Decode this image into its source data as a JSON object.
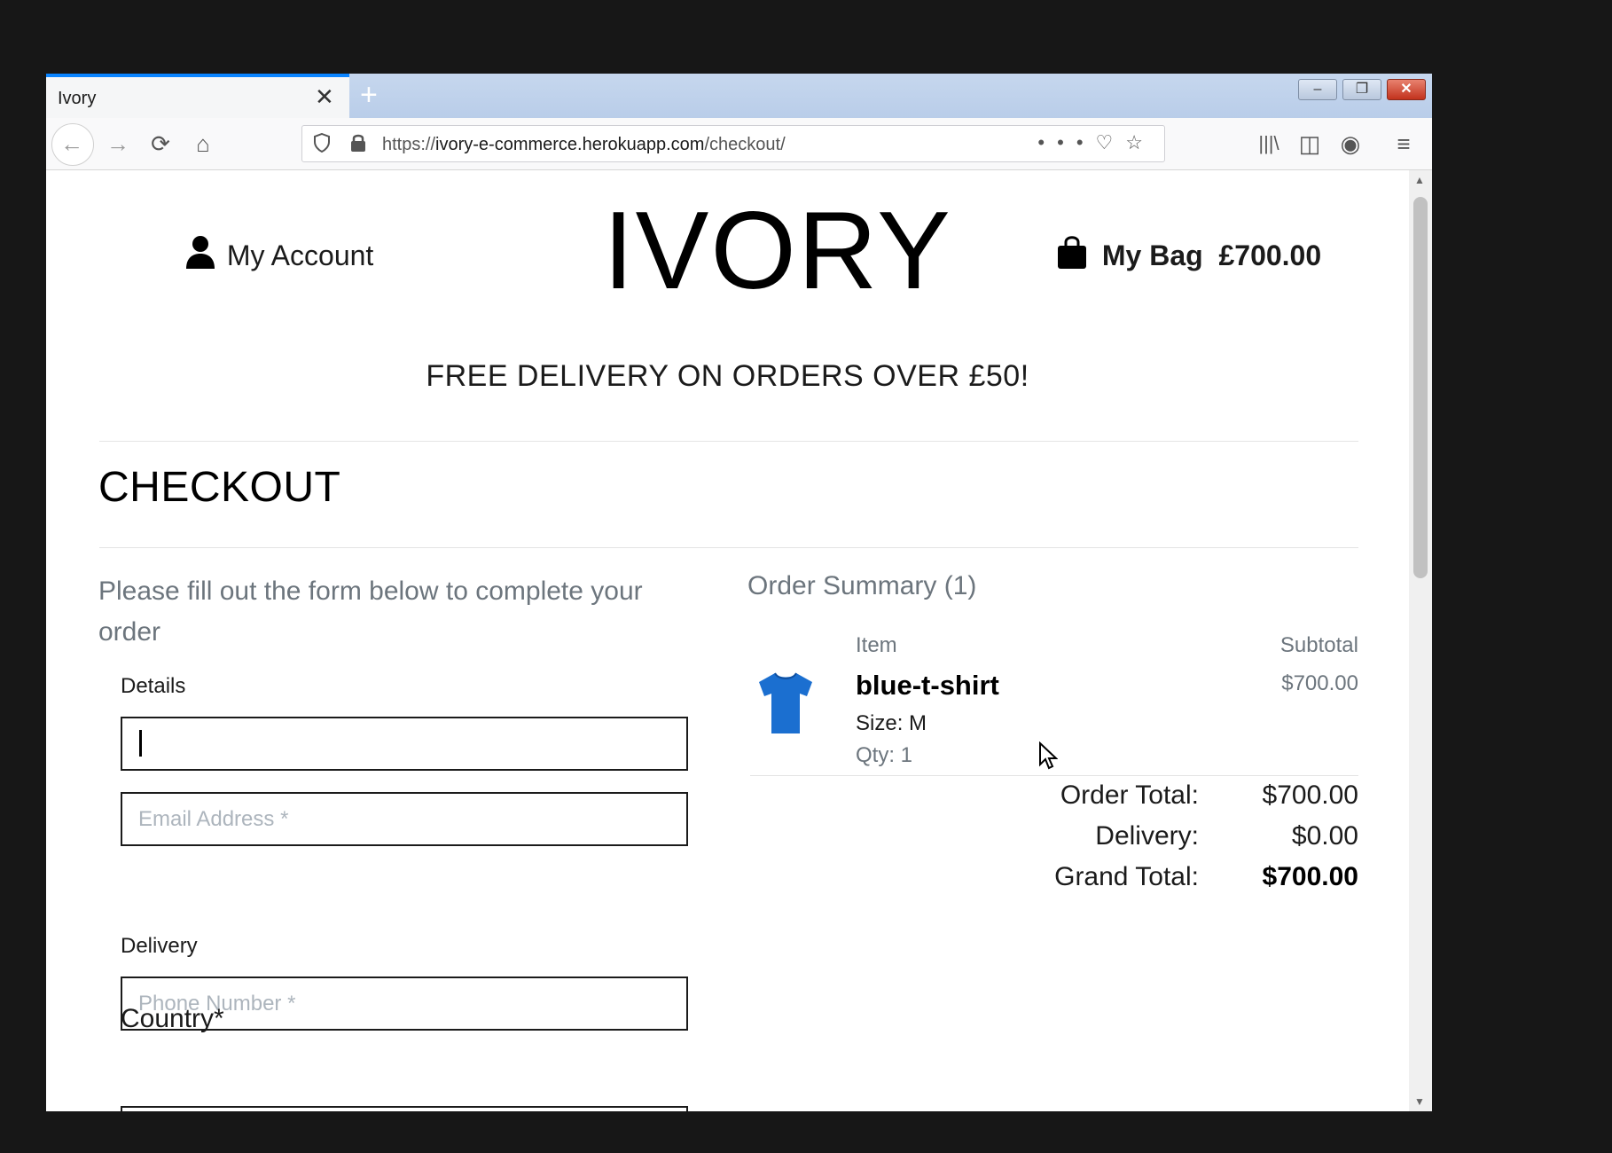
{
  "browser": {
    "tab_title": "Ivory",
    "tab_close": "✕",
    "new_tab": "+",
    "url_prefix": "https://",
    "url_host": "ivory-e-commerce.herokuapp.com",
    "url_path": "/checkout/",
    "url_menu": "•••"
  },
  "header": {
    "account_label": "My Account",
    "logo": "IVORY",
    "bag_label": "My Bag",
    "bag_total": "£700.00",
    "banner": "FREE DELIVERY ON ORDERS OVER £50!"
  },
  "checkout": {
    "title": "CHECKOUT",
    "intro": "Please fill out the form below to complete your order",
    "details_label": "Details",
    "name_value": "",
    "email_placeholder": "Email Address *",
    "delivery_label": "Delivery",
    "phone_placeholder": "Phone Number *",
    "country_label": "Country*"
  },
  "summary": {
    "title": "Order Summary (1)",
    "col_item": "Item",
    "col_subtotal": "Subtotal",
    "product": {
      "name": "blue-t-shirt",
      "size": "Size: M",
      "qty": "Qty: 1",
      "subtotal": "$700.00",
      "image_color": "#1b6fd0"
    },
    "order_total_label": "Order Total:",
    "order_total": "$700.00",
    "delivery_label": "Delivery:",
    "delivery": "$0.00",
    "grand_total_label": "Grand Total:",
    "grand_total": "$700.00"
  }
}
